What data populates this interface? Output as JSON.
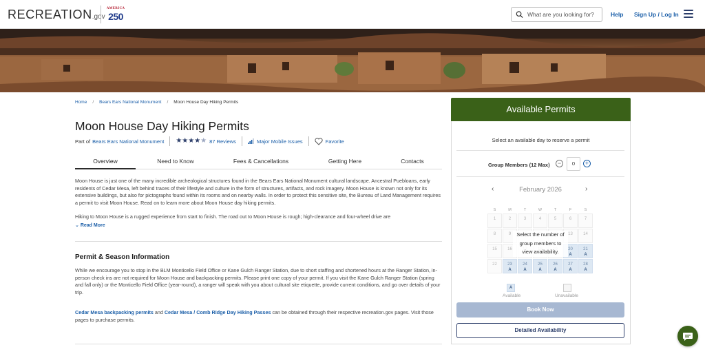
{
  "header": {
    "logo_text": "RECREATION",
    "logo_suffix": ".gov",
    "america250_top": "AMERICA",
    "america250_num": "250",
    "search_placeholder": "What are you looking for?",
    "help_label": "Help",
    "signup_label": "Sign Up / Log In",
    "icons": {
      "search": "search-icon",
      "menu": "hamburger-menu-icon"
    }
  },
  "breadcrumb": {
    "home": "Home",
    "parent": "Bears Ears National Monument",
    "current": "Moon House Day Hiking Permits",
    "separator": "/"
  },
  "page": {
    "title": "Moon House Day Hiking Permits",
    "part_of_prefix": "Part of",
    "part_of_link": "Bears Ears National Monument",
    "rating": 4.5,
    "reviews_label": "87 Reviews",
    "mobile_issues_label": "Major Mobile Issues",
    "favorite_label": "Favorite"
  },
  "tabs": [
    {
      "label": "Overview",
      "active": true
    },
    {
      "label": "Need to Know",
      "active": false
    },
    {
      "label": "Fees & Cancellations",
      "active": false
    },
    {
      "label": "Getting Here",
      "active": false
    },
    {
      "label": "Contacts",
      "active": false
    }
  ],
  "overview": {
    "p1": "Moon House is just one of the many incredible archeological structures found in the Bears Ears National Monument cultural landscape. Ancestral Puebloans, early residents of Cedar Mesa, left behind traces of their lifestyle and culture in the form of structures, artifacts, and rock imagery. Moon House is known not only for its extensive buildings, but also for pictographs found within its rooms and on nearby walls. In order to protect this sensitive site, the Bureau of Land Management requires a permit to visit Moon House. Read on to learn more about Moon House day hiking permits.",
    "p2": "Hiking to Moon House is a rugged experience from start to finish. The road out to Moon House is rough; high-clearance and four-wheel drive are",
    "read_more": "Read More"
  },
  "permit_section": {
    "heading": "Permit & Season Information",
    "p1": "While we encourage you to stop in the BLM Monticello Field Office or Kane Gulch Ranger Station, due to short staffing and shortened hours at the Ranger Station, in-person check ins are not required for Moon House and backpacking permits. Please print one copy of your permit. If you visit the Kane Gulch Ranger Station (spring and fall only) or the Monticello Field Office (year-round), a ranger will speak with you about cultural site etiquette, provide current conditions, and go over details of your trip.",
    "link1": "Cedar Mesa backpacking permits",
    "and_text": "and",
    "link2": "Cedar Mesa / Comb Ridge Day Hiking Passes",
    "p2_tail": "can be obtained through their respective recreation.gov pages. Visit those pages to purchase permits."
  },
  "sidebar": {
    "title": "Available Permits",
    "instruction": "Select an available day to reserve a permit",
    "group_label": "Group Members (12 Max)",
    "group_value": "0",
    "minus": "−",
    "plus": "+",
    "prev": "‹",
    "next": "›",
    "month": "February 2026",
    "weekdays": [
      "S",
      "M",
      "T",
      "W",
      "T",
      "F",
      "S"
    ],
    "weeks": [
      [
        {
          "d": "1"
        },
        {
          "d": "2"
        },
        {
          "d": "3"
        },
        {
          "d": "4"
        },
        {
          "d": "5"
        },
        {
          "d": "6"
        },
        {
          "d": "7"
        }
      ],
      [
        {
          "d": "8"
        },
        {
          "d": "9"
        },
        {
          "d": "10"
        },
        {
          "d": "11"
        },
        {
          "d": "12"
        },
        {
          "d": "13"
        },
        {
          "d": "14"
        }
      ],
      [
        {
          "d": "15"
        },
        {
          "d": "16"
        },
        {
          "d": "17"
        },
        {
          "d": "18"
        },
        {
          "d": "19"
        },
        {
          "d": "20",
          "a": "A"
        },
        {
          "d": "21",
          "a": "A"
        }
      ],
      [
        {
          "d": "22"
        },
        {
          "d": "23",
          "a": "A"
        },
        {
          "d": "24",
          "a": "A"
        },
        {
          "d": "25",
          "a": "A"
        },
        {
          "d": "26",
          "a": "A"
        },
        {
          "d": "27",
          "a": "A"
        },
        {
          "d": "28",
          "a": "A"
        }
      ]
    ],
    "overlay_line1": "Select the number of",
    "overlay_line2": "group members to",
    "overlay_line3": "view availability.",
    "legend_available_code": "A",
    "legend_available": "Available",
    "legend_unavailable": "Unavailable",
    "book_now": "Book Now",
    "detailed": "Detailed Availability"
  },
  "colors": {
    "accent_green": "#3a6118",
    "link_blue": "#1a5ea8",
    "navy": "#2c3e6a",
    "available_cell": "#dde8f3"
  }
}
